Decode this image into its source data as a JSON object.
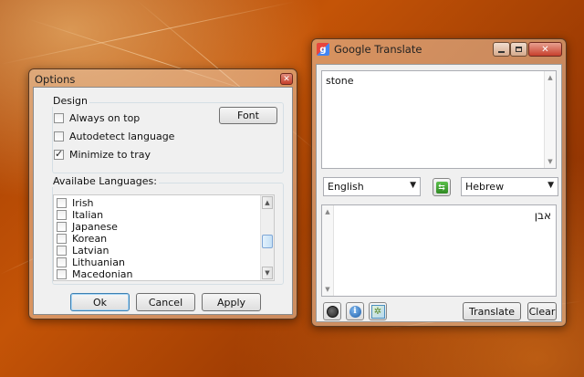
{
  "options": {
    "title": "Options",
    "design_label": "Design",
    "checkboxes": [
      {
        "label": "Always on top",
        "checked": false
      },
      {
        "label": "Autodetect language",
        "checked": false
      },
      {
        "label": "Minimize to tray",
        "checked": true
      }
    ],
    "font_button": "Font",
    "languages_label": "Availabe Languages:",
    "languages": [
      "Irish",
      "Italian",
      "Japanese",
      "Korean",
      "Latvian",
      "Lithuanian",
      "Macedonian"
    ],
    "ok_button": "Ok",
    "cancel_button": "Cancel",
    "apply_button": "Apply"
  },
  "translate": {
    "title": "Google Translate",
    "source_text": "stone",
    "source_lang": "English",
    "target_lang": "Hebrew",
    "result_text": "אבן",
    "translate_button": "Translate",
    "clear_button": "Clear"
  },
  "colors": {
    "desktop": "#b24705",
    "dialog_bg": "#f0f0f0",
    "close_red": "#c7402c"
  }
}
